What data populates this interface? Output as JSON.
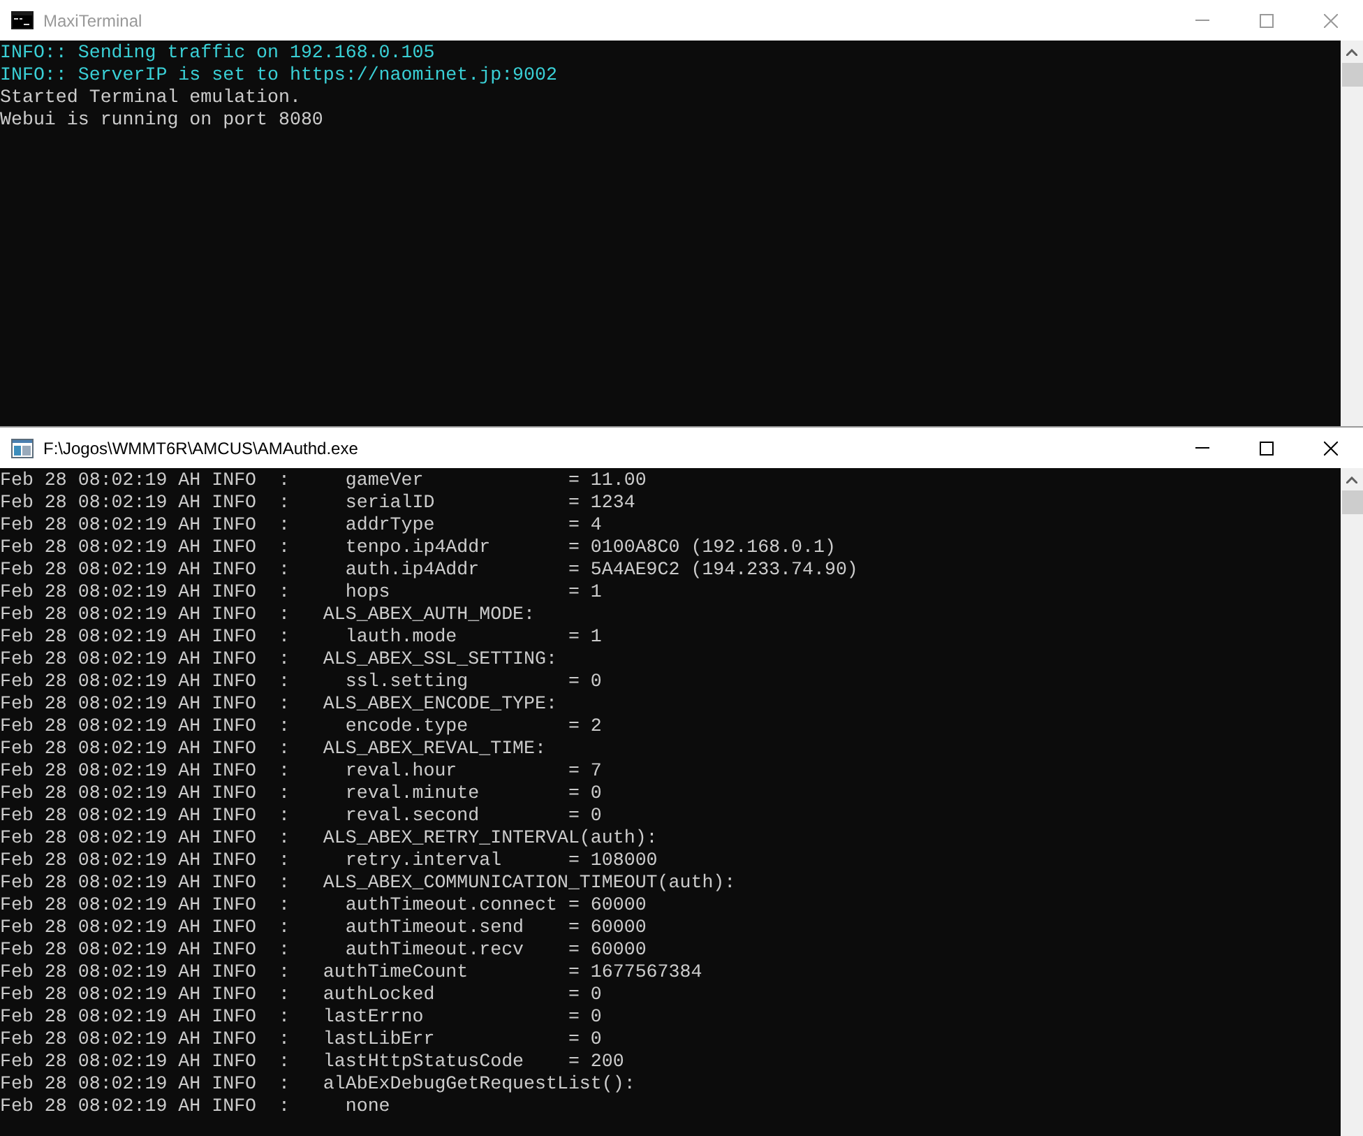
{
  "windows": [
    {
      "title": "MaxiTerminal",
      "active": false,
      "lines": [
        {
          "text": "INFO:: Sending traffic on 192.168.0.105",
          "color": "#3ad0d6"
        },
        {
          "text": "INFO:: ServerIP is set to https://naominet.jp:9002",
          "color": "#3ad0d6"
        },
        {
          "text": "Started Terminal emulation.",
          "color": "#cccccc"
        },
        {
          "text": "Webui is running on port 8080",
          "color": "#cccccc"
        }
      ]
    },
    {
      "title": "F:\\Jogos\\WMMT6R\\AMCUS\\AMAuthd.exe",
      "active": true,
      "lines": [
        {
          "text": "Feb 28 08:02:19 AH INFO  :     gameVer             = 11.00",
          "color": "#cccccc"
        },
        {
          "text": "Feb 28 08:02:19 AH INFO  :     serialID            = 1234",
          "color": "#cccccc"
        },
        {
          "text": "Feb 28 08:02:19 AH INFO  :     addrType            = 4",
          "color": "#cccccc"
        },
        {
          "text": "Feb 28 08:02:19 AH INFO  :     tenpo.ip4Addr       = 0100A8C0 (192.168.0.1)",
          "color": "#cccccc"
        },
        {
          "text": "Feb 28 08:02:19 AH INFO  :     auth.ip4Addr        = 5A4AE9C2 (194.233.74.90)",
          "color": "#cccccc"
        },
        {
          "text": "Feb 28 08:02:19 AH INFO  :     hops                = 1",
          "color": "#cccccc"
        },
        {
          "text": "Feb 28 08:02:19 AH INFO  :   ALS_ABEX_AUTH_MODE:",
          "color": "#cccccc"
        },
        {
          "text": "Feb 28 08:02:19 AH INFO  :     lauth.mode          = 1",
          "color": "#cccccc"
        },
        {
          "text": "Feb 28 08:02:19 AH INFO  :   ALS_ABEX_SSL_SETTING:",
          "color": "#cccccc"
        },
        {
          "text": "Feb 28 08:02:19 AH INFO  :     ssl.setting         = 0",
          "color": "#cccccc"
        },
        {
          "text": "Feb 28 08:02:19 AH INFO  :   ALS_ABEX_ENCODE_TYPE:",
          "color": "#cccccc"
        },
        {
          "text": "Feb 28 08:02:19 AH INFO  :     encode.type         = 2",
          "color": "#cccccc"
        },
        {
          "text": "Feb 28 08:02:19 AH INFO  :   ALS_ABEX_REVAL_TIME:",
          "color": "#cccccc"
        },
        {
          "text": "Feb 28 08:02:19 AH INFO  :     reval.hour          = 7",
          "color": "#cccccc"
        },
        {
          "text": "Feb 28 08:02:19 AH INFO  :     reval.minute        = 0",
          "color": "#cccccc"
        },
        {
          "text": "Feb 28 08:02:19 AH INFO  :     reval.second        = 0",
          "color": "#cccccc"
        },
        {
          "text": "Feb 28 08:02:19 AH INFO  :   ALS_ABEX_RETRY_INTERVAL(auth):",
          "color": "#cccccc"
        },
        {
          "text": "Feb 28 08:02:19 AH INFO  :     retry.interval      = 108000",
          "color": "#cccccc"
        },
        {
          "text": "Feb 28 08:02:19 AH INFO  :   ALS_ABEX_COMMUNICATION_TIMEOUT(auth):",
          "color": "#cccccc"
        },
        {
          "text": "Feb 28 08:02:19 AH INFO  :     authTimeout.connect = 60000",
          "color": "#cccccc"
        },
        {
          "text": "Feb 28 08:02:19 AH INFO  :     authTimeout.send    = 60000",
          "color": "#cccccc"
        },
        {
          "text": "Feb 28 08:02:19 AH INFO  :     authTimeout.recv    = 60000",
          "color": "#cccccc"
        },
        {
          "text": "Feb 28 08:02:19 AH INFO  :   authTimeCount         = 1677567384",
          "color": "#cccccc"
        },
        {
          "text": "Feb 28 08:02:19 AH INFO  :   authLocked            = 0",
          "color": "#cccccc"
        },
        {
          "text": "Feb 28 08:02:19 AH INFO  :   lastErrno             = 0",
          "color": "#cccccc"
        },
        {
          "text": "Feb 28 08:02:19 AH INFO  :   lastLibErr            = 0",
          "color": "#cccccc"
        },
        {
          "text": "Feb 28 08:02:19 AH INFO  :   lastHttpStatusCode    = 200",
          "color": "#cccccc"
        },
        {
          "text": "Feb 28 08:02:19 AH INFO  :   alAbExDebugGetRequestList():",
          "color": "#cccccc"
        },
        {
          "text": "Feb 28 08:02:19 AH INFO  :     none",
          "color": "#cccccc"
        }
      ]
    }
  ]
}
